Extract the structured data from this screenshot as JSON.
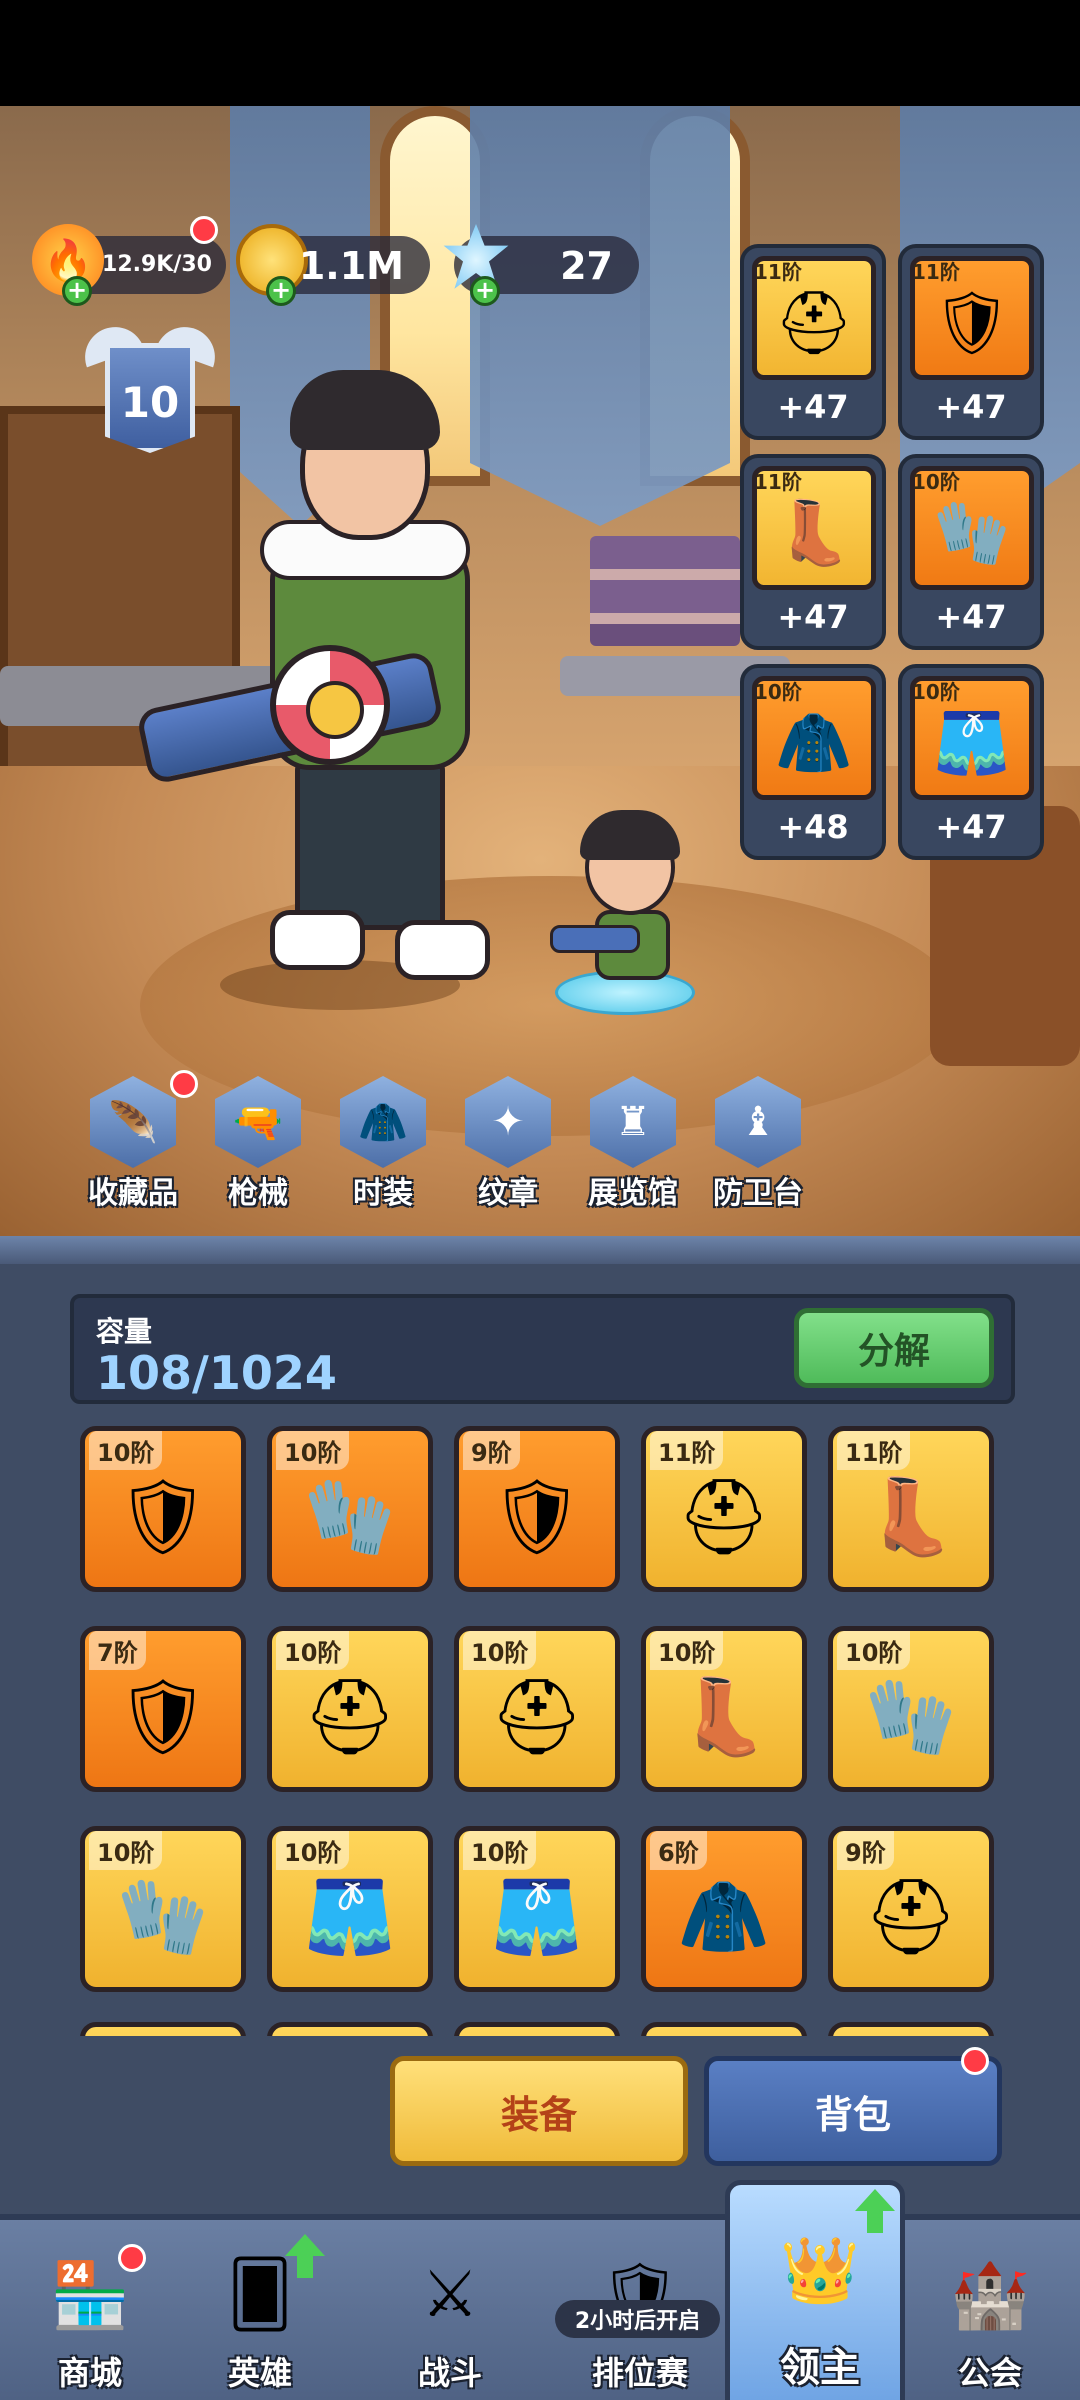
{
  "resources": {
    "energy": "12.9K/30",
    "gold": "1.1M",
    "gems": "27"
  },
  "player_level": "10",
  "equipped": [
    {
      "tier": "11阶",
      "bonus": "+47",
      "gear": "helmet",
      "rarity": "gold"
    },
    {
      "tier": "11阶",
      "bonus": "+47",
      "gear": "armor",
      "rarity": "orange"
    },
    {
      "tier": "11阶",
      "bonus": "+47",
      "gear": "boots",
      "rarity": "gold"
    },
    {
      "tier": "10阶",
      "bonus": "+47",
      "gear": "gloves",
      "rarity": "orange"
    },
    {
      "tier": "10阶",
      "bonus": "+48",
      "gear": "cape",
      "rarity": "orange"
    },
    {
      "tier": "10阶",
      "bonus": "+47",
      "gear": "belt",
      "rarity": "orange"
    }
  ],
  "features": [
    "收藏品",
    "枪械",
    "时装",
    "纹章",
    "展览馆",
    "防卫台"
  ],
  "inventory": {
    "capacity_label": "容量",
    "capacity_value": "108/1024",
    "decompose_label": "分解",
    "items": [
      {
        "tier": "10阶",
        "gear": "armor",
        "rarity": "orange"
      },
      {
        "tier": "10阶",
        "gear": "gloves",
        "rarity": "orange"
      },
      {
        "tier": "9阶",
        "gear": "armor",
        "rarity": "orange"
      },
      {
        "tier": "11阶",
        "gear": "helmet",
        "rarity": "gold"
      },
      {
        "tier": "11阶",
        "gear": "boots",
        "rarity": "gold"
      },
      {
        "tier": "7阶",
        "gear": "armor",
        "rarity": "orange"
      },
      {
        "tier": "10阶",
        "gear": "helmet",
        "rarity": "gold"
      },
      {
        "tier": "10阶",
        "gear": "helmet",
        "rarity": "gold"
      },
      {
        "tier": "10阶",
        "gear": "boots",
        "rarity": "gold"
      },
      {
        "tier": "10阶",
        "gear": "gloves",
        "rarity": "gold"
      },
      {
        "tier": "10阶",
        "gear": "gloves",
        "rarity": "gold"
      },
      {
        "tier": "10阶",
        "gear": "belt",
        "rarity": "gold"
      },
      {
        "tier": "10阶",
        "gear": "belt",
        "rarity": "gold"
      },
      {
        "tier": "6阶",
        "gear": "cape",
        "rarity": "orange"
      },
      {
        "tier": "9阶",
        "gear": "helmet",
        "rarity": "gold"
      }
    ]
  },
  "buttons": {
    "equip": "装备",
    "bag": "背包"
  },
  "nav": {
    "items": [
      "商城",
      "英雄",
      "战斗",
      "排位赛",
      "领主",
      "公会"
    ],
    "active_index": 4,
    "ranked_tag": "2小时后开启"
  }
}
